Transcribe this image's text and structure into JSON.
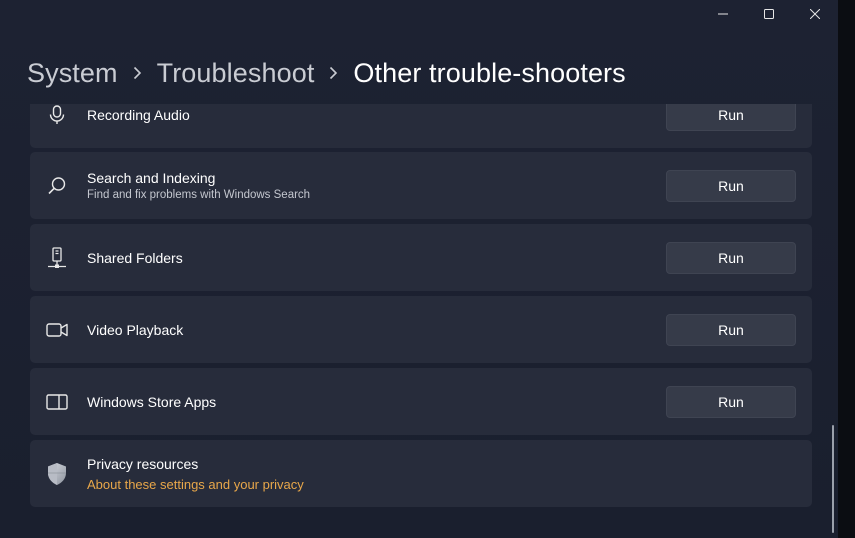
{
  "window": {
    "caption_buttons": [
      "minimize-icon",
      "maximize-icon",
      "close-icon"
    ]
  },
  "breadcrumb": {
    "items": [
      "System",
      "Troubleshoot",
      "Other trouble-shooters"
    ]
  },
  "troubleshooters": [
    {
      "title": "Recording Audio",
      "description": "",
      "icon": "microphone-icon",
      "button": "Run"
    },
    {
      "title": "Search and Indexing",
      "description": "Find and fix problems with Windows Search",
      "icon": "search-icon",
      "button": "Run"
    },
    {
      "title": "Shared Folders",
      "description": "",
      "icon": "shared-folders-icon",
      "button": "Run"
    },
    {
      "title": "Video Playback",
      "description": "",
      "icon": "video-camera-icon",
      "button": "Run"
    },
    {
      "title": "Windows Store Apps",
      "description": "",
      "icon": "store-apps-icon",
      "button": "Run"
    }
  ],
  "privacy": {
    "title": "Privacy resources",
    "link": "About these settings and your privacy",
    "icon": "shield-icon"
  },
  "colors": {
    "background": "#1c2130",
    "card": "#272c3b",
    "button": "#363b49",
    "link": "#e8a74a"
  }
}
